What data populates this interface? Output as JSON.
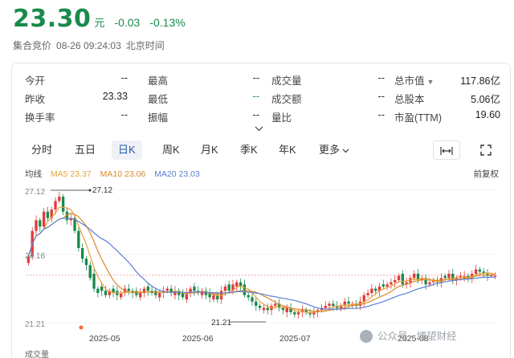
{
  "quote": {
    "price": "23.30",
    "unit": "元",
    "change": "-0.03",
    "change_pct": "-0.13%",
    "session": "集合竞价",
    "datetime": "08-26 09:24:03",
    "timezone": "北京时间"
  },
  "stats": [
    [
      {
        "label": "今开",
        "value": "--"
      },
      {
        "label": "最高",
        "value": "--"
      },
      {
        "label": "成交量",
        "value": "--"
      },
      {
        "label": "总市值",
        "value": "117.86亿"
      }
    ],
    [
      {
        "label": "昨收",
        "value": "23.33"
      },
      {
        "label": "最低",
        "value": "--"
      },
      {
        "label": "成交额",
        "value": "--"
      },
      {
        "label": "总股本",
        "value": "5.06亿"
      }
    ],
    [
      {
        "label": "换手率",
        "value": "--"
      },
      {
        "label": "振幅",
        "value": "--"
      },
      {
        "label": "量比",
        "value": "--"
      },
      {
        "label": "市盈(TTM)",
        "value": "19.60"
      }
    ]
  ],
  "tabs": [
    "分时",
    "五日",
    "日K",
    "周K",
    "月K",
    "季K",
    "年K",
    "更多"
  ],
  "active_tab": "日K",
  "ma": {
    "label": "均线",
    "ma5": "MA5 23.37",
    "ma10": "MA10 23.06",
    "ma20": "MA20 23.03"
  },
  "adjust_label": "前复权",
  "colors": {
    "up": "#e23b3b",
    "down": "#1a8a4c",
    "ma5": "#e8a23a",
    "ma10": "#d98a2b",
    "ma20": "#5b7fd4",
    "active_tab": "#2a5db0"
  },
  "icons": {
    "fullscreen": "fullscreen-icon",
    "fit": "fit-width-icon",
    "expand": "chevron-down-icon"
  },
  "chart_data": {
    "type": "candlestick",
    "y_ticks": [
      "27.12",
      "24.16",
      "21.21"
    ],
    "ylim": [
      21.21,
      27.12
    ],
    "x_labels": [
      "2025-05",
      "2025-06",
      "2025-07",
      "2025-08"
    ],
    "annotations": {
      "high": "27.12",
      "low": "21.21"
    },
    "volume_label": "成交量",
    "watermark": "公众号 · 博望财经",
    "closes": [
      24.2,
      25.4,
      25.9,
      25.6,
      26.3,
      26.0,
      26.4,
      26.8,
      27.0,
      26.3,
      25.9,
      26.0,
      25.4,
      24.6,
      24.1,
      23.8,
      23.2,
      22.7,
      22.5,
      22.6,
      22.4,
      22.6,
      22.5,
      22.4,
      22.5,
      22.7,
      22.6,
      22.5,
      22.4,
      22.5,
      22.7,
      22.6,
      22.5,
      22.4,
      22.5,
      22.6,
      22.7,
      22.5,
      22.6,
      22.4,
      22.3,
      22.5,
      22.7,
      22.6,
      22.5,
      22.6,
      22.4,
      22.3,
      22.4,
      22.2,
      22.6,
      22.8,
      22.6,
      22.9,
      23.0,
      22.8,
      22.4,
      22.3,
      22.1,
      21.9,
      21.8,
      21.8,
      21.7,
      21.9,
      22.0,
      21.8,
      21.7,
      21.8,
      21.6,
      21.5,
      21.6,
      21.7,
      21.6,
      21.5,
      21.6,
      21.7,
      21.8,
      21.9,
      22.0,
      21.9,
      21.8,
      21.9,
      22.1,
      22.0,
      22.0,
      21.9,
      22.1,
      22.4,
      22.5,
      22.7,
      22.6,
      22.8,
      22.8,
      22.9,
      23.0,
      23.1,
      23.3,
      22.9,
      23.0,
      23.2,
      23.4,
      23.1,
      23.2,
      22.9,
      23.0,
      23.1,
      23.0,
      23.2,
      23.2,
      23.4,
      23.1,
      23.2,
      23.3,
      23.3,
      23.2,
      23.4,
      23.6,
      23.5,
      23.4,
      23.3,
      23.33,
      23.3
    ],
    "opens": [
      23.9,
      24.2,
      25.4,
      25.9,
      25.6,
      26.3,
      26.0,
      26.4,
      26.8,
      27.0,
      26.3,
      25.9,
      26.0,
      25.4,
      24.6,
      24.1,
      23.8,
      23.4,
      22.7,
      22.8,
      22.6,
      22.4,
      22.7,
      22.6,
      22.3,
      22.5,
      22.7,
      22.6,
      22.6,
      22.3,
      22.5,
      22.8,
      22.6,
      22.6,
      22.3,
      22.5,
      22.6,
      22.7,
      22.4,
      22.6,
      22.5,
      22.2,
      22.5,
      22.8,
      22.6,
      22.4,
      22.6,
      22.5,
      22.2,
      22.4,
      22.2,
      22.6,
      22.9,
      22.6,
      22.8,
      23.0,
      22.9,
      22.4,
      22.3,
      22.1,
      21.9,
      21.7,
      21.8,
      21.7,
      21.9,
      22.0,
      21.8,
      21.6,
      21.8,
      21.6,
      21.5,
      21.6,
      21.7,
      21.6,
      21.5,
      21.6,
      21.7,
      21.8,
      21.9,
      22.0,
      21.9,
      21.8,
      21.9,
      22.1,
      21.9,
      22.0,
      21.9,
      22.1,
      22.4,
      22.5,
      22.7,
      22.6,
      22.9,
      22.8,
      22.9,
      23.0,
      23.1,
      23.4,
      22.9,
      23.0,
      23.2,
      23.4,
      23.1,
      23.2,
      22.9,
      23.0,
      23.1,
      23.0,
      23.3,
      23.2,
      23.4,
      23.1,
      23.2,
      23.2,
      23.3,
      23.2,
      23.4,
      23.6,
      23.5,
      23.4,
      23.33,
      23.3
    ]
  }
}
